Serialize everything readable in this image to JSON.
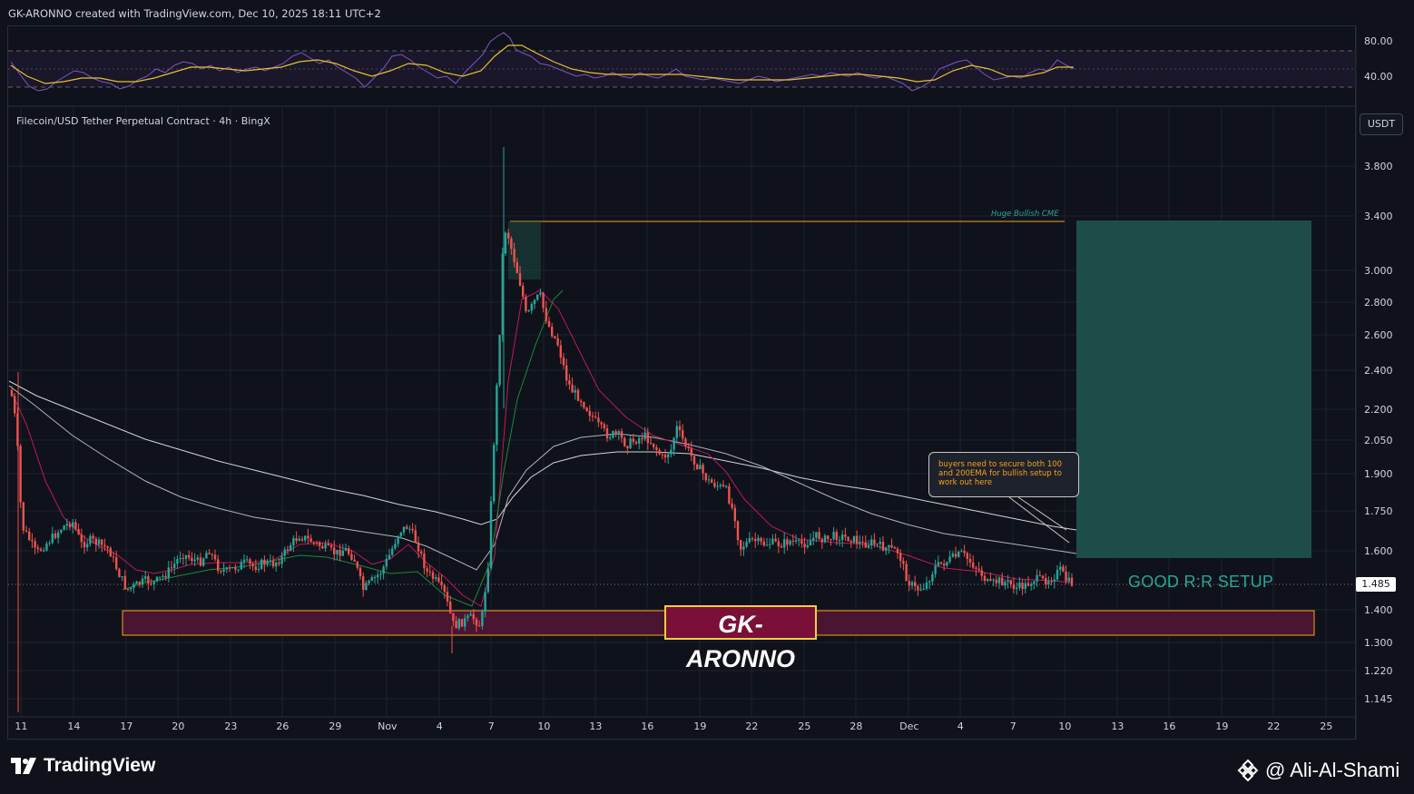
{
  "header": {
    "created_text": "GK-ARONNO created with TradingView.com, Dec 10, 2025 18:11 UTC+2"
  },
  "rsi_panel": {
    "scale_labels": [
      "80.00",
      "40.00"
    ]
  },
  "main_panel": {
    "symbol_title": "Filecoin/USD Tether Perpetual Contract · 4h · BingX",
    "currency_button": "USDT",
    "current_price": "1.485",
    "price_axis_labels": [
      "3.800",
      "3.400",
      "3.000",
      "2.800",
      "2.600",
      "2.400",
      "2.200",
      "2.050",
      "1.900",
      "1.750",
      "1.600",
      "1.400",
      "1.300",
      "1.220",
      "1.145"
    ],
    "time_axis_labels": [
      "11",
      "14",
      "17",
      "20",
      "23",
      "26",
      "29",
      "Nov",
      "4",
      "7",
      "10",
      "13",
      "16",
      "19",
      "22",
      "25",
      "28",
      "Dec",
      "4",
      "7",
      "10",
      "13",
      "16",
      "19",
      "22",
      "25"
    ]
  },
  "annotations": {
    "watermark": "GK-ARONNO",
    "cme_label": "Huge Bullish CME",
    "callout_text": "buyers need to secure both 100 and 200EMA for bullish setup to work out here",
    "rr_label": "GOOD R:R SETUP"
  },
  "footer": {
    "brand": "TradingView",
    "author": "@ Ali-Al-Shami"
  },
  "colors": {
    "background": "#131722",
    "bull_candle": "#26a69a",
    "bear_candle": "#ef5350",
    "zone_fill": "#4a1530",
    "zone_border": "#f7a21b",
    "target_box": "#1d4d46",
    "ema_red": "#e0245e",
    "ema_white": "#d1d4dc",
    "rsi_line": "#7e57c2",
    "rsi_ma": "#e5c12f"
  }
}
